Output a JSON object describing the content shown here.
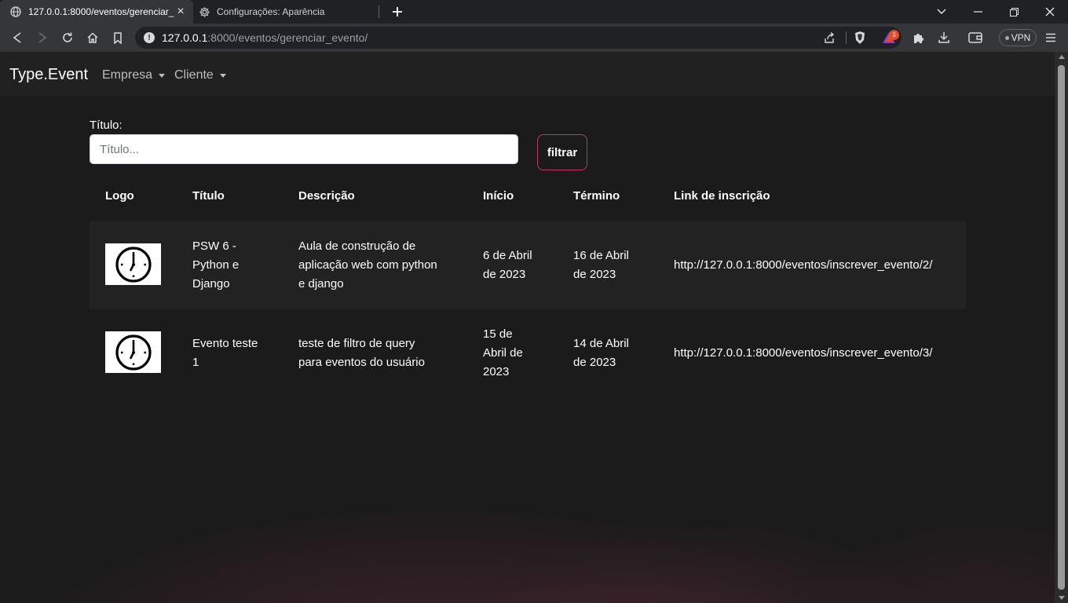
{
  "browser": {
    "tabs": [
      {
        "title": "127.0.0.1:8000/eventos/gerenciar_evento/",
        "favicon": "globe-icon",
        "active": true
      },
      {
        "title": "Configurações: Aparência",
        "favicon": "gear-icon",
        "active": false
      }
    ],
    "address": {
      "host": "127.0.0.1",
      "rest": ":8000/eventos/gerenciar_evento/"
    },
    "vpn_label": "VPN",
    "rewards_badge": "3"
  },
  "navbar": {
    "brand": "Type.Event",
    "menus": [
      "Empresa",
      "Cliente"
    ]
  },
  "filter": {
    "label": "Título:",
    "placeholder": "Título...",
    "value": "",
    "button": "filtrar"
  },
  "table": {
    "headers": [
      "Logo",
      "Título",
      "Descrição",
      "Início",
      "Término",
      "Link de inscrição"
    ],
    "rows": [
      {
        "logo": "clock-icon",
        "title": [
          "PSW 6 -",
          "Python e",
          "Django"
        ],
        "description": [
          "Aula de construção de",
          "aplicação web com python",
          "e django"
        ],
        "start": [
          "6 de Abril",
          "de 2023"
        ],
        "end": [
          "16 de Abril",
          "de 2023"
        ],
        "link": "http://127.0.0.1:8000/eventos/inscrever_evento/2/"
      },
      {
        "logo": "clock-icon",
        "title": [
          "Evento teste",
          "1"
        ],
        "description": [
          "teste de filtro de query",
          "para eventos do usuário"
        ],
        "start": [
          "15 de",
          "Abril de",
          "2023"
        ],
        "end": [
          "14 de Abril",
          "de 2023"
        ],
        "link": "http://127.0.0.1:8000/eventos/inscrever_evento/3/"
      }
    ]
  },
  "colors": {
    "page_bg": "#1c1b1c",
    "navbar_bg": "#212121",
    "button_border": "#b83a5e",
    "browser_toolbar": "#35363a"
  }
}
